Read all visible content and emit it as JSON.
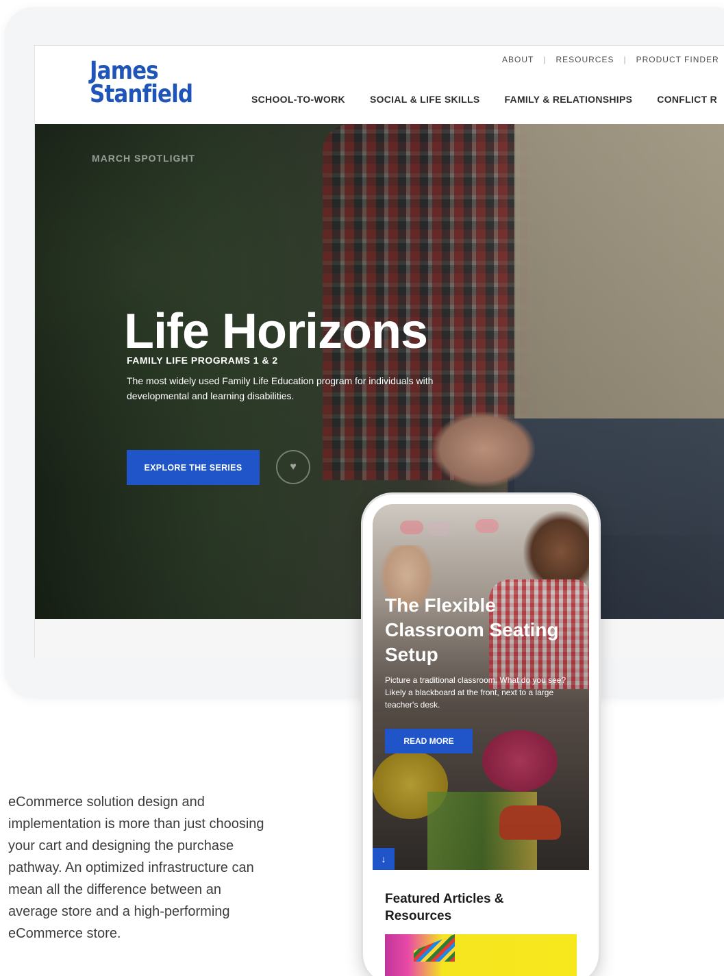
{
  "site": {
    "logo_line1": "James",
    "logo_line2": "Stanfield",
    "utility_nav": [
      "ABOUT",
      "RESOURCES",
      "PRODUCT FINDER"
    ],
    "main_nav": [
      "SCHOOL-TO-WORK",
      "SOCIAL & LIFE SKILLS",
      "FAMILY & RELATIONSHIPS",
      "CONFLICT R"
    ],
    "hero": {
      "kicker": "MARCH SPOTLIGHT",
      "title": "Life Horizons",
      "subtitle": "FAMILY LIFE PROGRAMS 1 & 2",
      "description": "The most widely used Family Life Education program for individuals with developmental and learning disabilities.",
      "cta": "EXPLORE THE SERIES"
    }
  },
  "mobile": {
    "title": "The Flexible Classroom Seating Setup",
    "description": "Picture a traditional classroom. What do you see? Likely a blackboard at the front, next to a large teacher's desk.",
    "cta": "READ MORE",
    "arrow": "↓",
    "featured_heading": "Featured Articles & Resources"
  },
  "body_copy": "eCommerce solution design and implementation is more than just choosing your cart and designing the purchase pathway. An optimized infrastructure can mean all the difference between an average store and a high-performing eCommerce store.",
  "colors": {
    "brand_blue": "#1f55b8",
    "cta_blue": "#1f55c9"
  }
}
